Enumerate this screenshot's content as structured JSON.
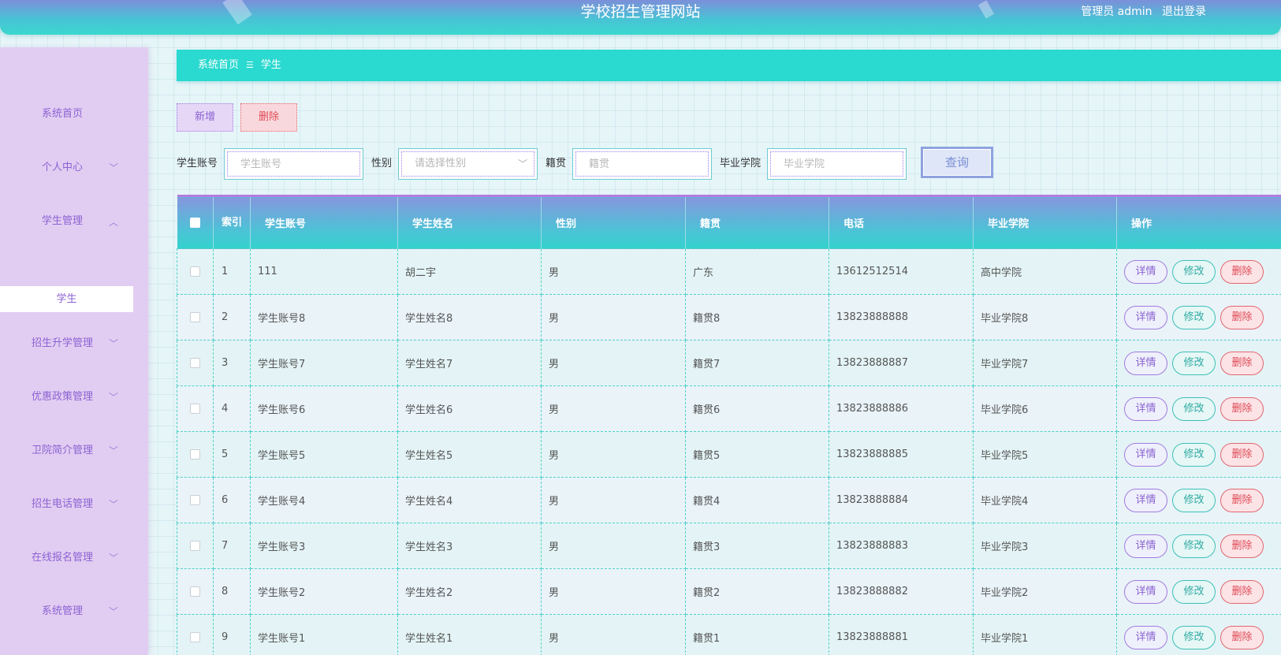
{
  "header": {
    "title": "学校招生管理网站",
    "admin_label": "管理员 admin",
    "logout_label": "退出登录"
  },
  "sidebar": {
    "items": [
      {
        "label": "系统首页",
        "arrow": ""
      },
      {
        "label": "个人中心",
        "arrow": "down"
      },
      {
        "label": "学生管理",
        "arrow": "up"
      },
      {
        "label": "招生升学管理",
        "arrow": "down"
      },
      {
        "label": "优惠政策管理",
        "arrow": "down"
      },
      {
        "label": "卫院简介管理",
        "arrow": "down"
      },
      {
        "label": "招生电话管理",
        "arrow": "down"
      },
      {
        "label": "在线报名管理",
        "arrow": "down"
      },
      {
        "label": "系统管理",
        "arrow": "down"
      }
    ],
    "active_submenu": "学生"
  },
  "breadcrumb": {
    "home": "系统首页",
    "separator": "☰",
    "current": "学生"
  },
  "toolbar": {
    "add_label": "新增",
    "delete_label": "删除"
  },
  "search": {
    "account_label": "学生账号",
    "account_placeholder": "学生账号",
    "gender_label": "性别",
    "gender_placeholder": "请选择性别",
    "origin_label": "籍贯",
    "origin_placeholder": "籍贯",
    "school_label": "毕业学院",
    "school_placeholder": "毕业学院",
    "query_label": "查询"
  },
  "table": {
    "headers": {
      "index": "索引",
      "account": "学生账号",
      "name": "学生姓名",
      "gender": "性别",
      "origin": "籍贯",
      "phone": "电话",
      "school": "毕业学院",
      "ops": "操作"
    },
    "op_labels": {
      "detail": "详情",
      "edit": "修改",
      "delete": "删除"
    },
    "rows": [
      {
        "index": "1",
        "account": "111",
        "name": "胡二宇",
        "gender": "男",
        "origin": "广东",
        "phone": "13612512514",
        "school": "高中学院"
      },
      {
        "index": "2",
        "account": "学生账号8",
        "name": "学生姓名8",
        "gender": "男",
        "origin": "籍贯8",
        "phone": "13823888888",
        "school": "毕业学院8"
      },
      {
        "index": "3",
        "account": "学生账号7",
        "name": "学生姓名7",
        "gender": "男",
        "origin": "籍贯7",
        "phone": "13823888887",
        "school": "毕业学院7"
      },
      {
        "index": "4",
        "account": "学生账号6",
        "name": "学生姓名6",
        "gender": "男",
        "origin": "籍贯6",
        "phone": "13823888886",
        "school": "毕业学院6"
      },
      {
        "index": "5",
        "account": "学生账号5",
        "name": "学生姓名5",
        "gender": "男",
        "origin": "籍贯5",
        "phone": "13823888885",
        "school": "毕业学院5"
      },
      {
        "index": "6",
        "account": "学生账号4",
        "name": "学生姓名4",
        "gender": "男",
        "origin": "籍贯4",
        "phone": "13823888884",
        "school": "毕业学院4"
      },
      {
        "index": "7",
        "account": "学生账号3",
        "name": "学生姓名3",
        "gender": "男",
        "origin": "籍贯3",
        "phone": "13823888883",
        "school": "毕业学院3"
      },
      {
        "index": "8",
        "account": "学生账号2",
        "name": "学生姓名2",
        "gender": "男",
        "origin": "籍贯2",
        "phone": "13823888882",
        "school": "毕业学院2"
      },
      {
        "index": "9",
        "account": "学生账号1",
        "name": "学生姓名1",
        "gender": "男",
        "origin": "籍贯1",
        "phone": "13823888881",
        "school": "毕业学院1"
      }
    ]
  }
}
